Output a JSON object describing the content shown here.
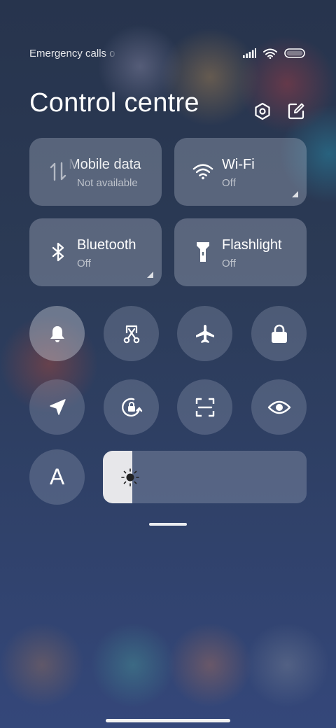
{
  "status_bar": {
    "carrier_text": "Emergency calls o",
    "icons": [
      "signal-icon",
      "wifi-icon",
      "battery-icon"
    ]
  },
  "header": {
    "title": "Control centre",
    "actions": [
      "settings-icon",
      "edit-icon"
    ]
  },
  "big_tiles": [
    {
      "name": "mobile-data",
      "label": "Mobile data",
      "status": "Not available",
      "icon": "mobile-data-icon"
    },
    {
      "name": "wifi",
      "label": "Wi-Fi",
      "status": "Off",
      "icon": "wifi-icon"
    },
    {
      "name": "bluetooth",
      "label": "Bluetooth",
      "status": "Off",
      "icon": "bluetooth-icon"
    },
    {
      "name": "flashlight",
      "label": "Flashlight",
      "status": "Off",
      "icon": "flashlight-icon"
    }
  ],
  "toggles_row1": [
    "bell-icon",
    "screenshot-icon",
    "airplane-icon",
    "lock-icon"
  ],
  "toggles_row2": [
    "location-icon",
    "rotation-lock-icon",
    "scan-icon",
    "eye-icon"
  ],
  "font_button": {
    "label": "A"
  },
  "brightness": {
    "level": 0.145,
    "icon": "brightness-icon"
  },
  "colors": {
    "accent": "#ffffff",
    "slider_fill": "#e7e7ea"
  }
}
